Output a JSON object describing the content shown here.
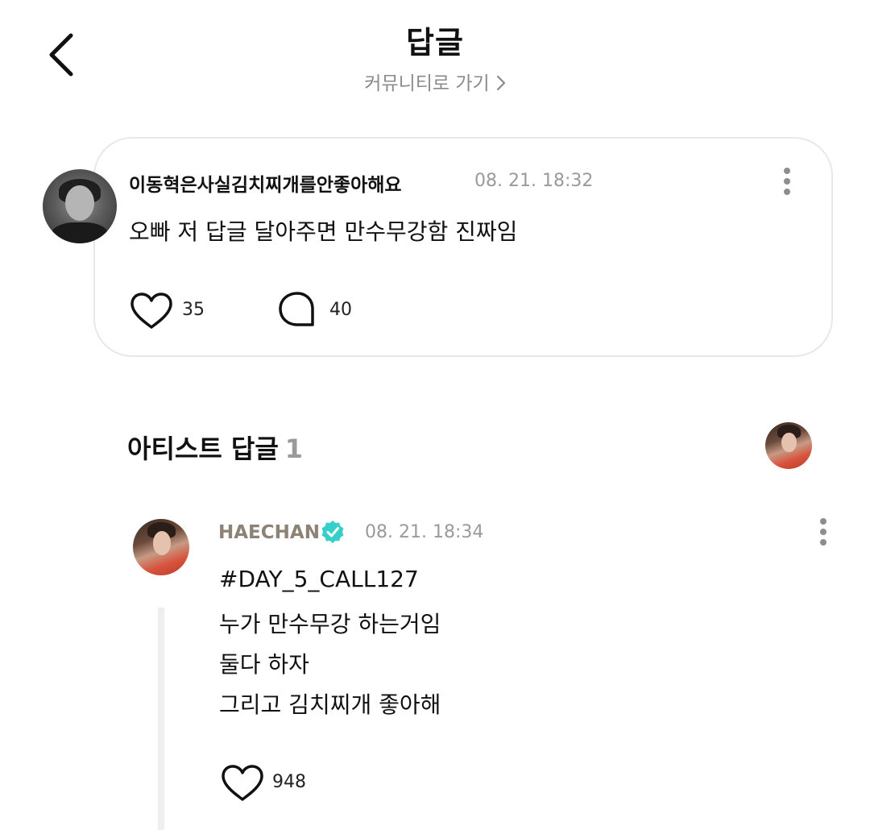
{
  "header": {
    "title": "답글",
    "community_link": "커뮤니티로 가기"
  },
  "post": {
    "author": "이동혁은사실김치찌개를안좋아해요",
    "time": "08. 21. 18:32",
    "text": "오빠 저 답글 달아주면 만수무강함 진짜임",
    "likes": "35",
    "comments": "40"
  },
  "artist_section": {
    "title": "아티스트 답글",
    "count": "1"
  },
  "artist_reply": {
    "author": "HAECHAN",
    "time": "08. 21. 18:34",
    "lines": [
      "#DAY_5_CALL127",
      "누가 만수무강 하는거임",
      "둘다 하자",
      "그리고 김치찌개 좋아해"
    ],
    "likes": "948"
  },
  "colors": {
    "verified": "#35d0c9",
    "artist_name": "#8c8276",
    "muted": "#9a9a9a"
  },
  "icons": [
    "back-arrow-icon",
    "chevron-right-icon",
    "more-vertical-icon",
    "heart-icon",
    "comment-bubble-icon",
    "verified-badge-icon"
  ]
}
